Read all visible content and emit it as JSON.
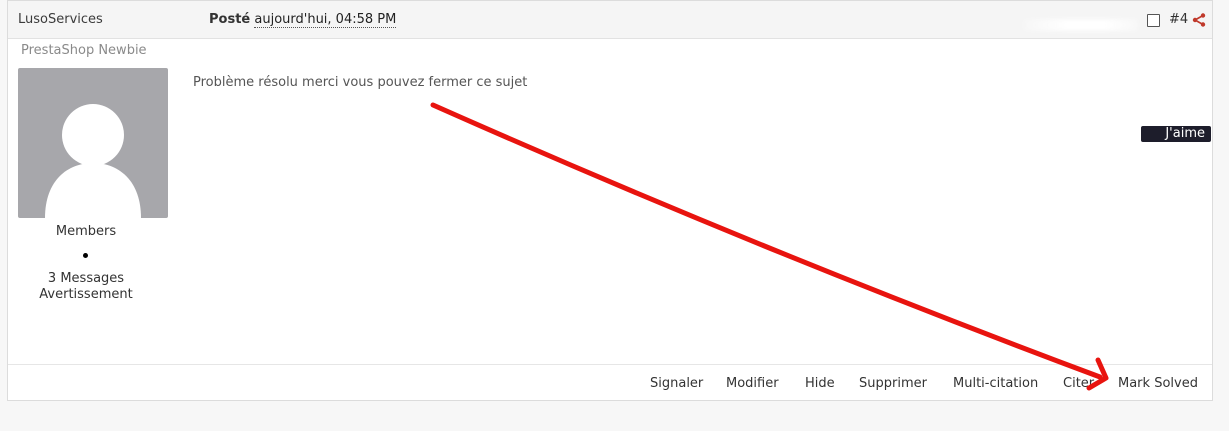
{
  "post": {
    "author": "LusoServices",
    "posted_prefix": "Posté",
    "posted_date": "aujourd'hui, 04:58 PM",
    "post_number": "#4",
    "rank": "PrestaShop Newbie",
    "group": "Members",
    "messages": "3 Messages",
    "warning": "Avertissement",
    "body": "Problème résolu merci vous pouvez fermer ce sujet",
    "like_label": "J'aime"
  },
  "controls": {
    "report": "Signaler",
    "edit": "Modifier",
    "hide": "Hide",
    "delete": "Supprimer",
    "multiquote": "Multi-citation",
    "quote": "Citer",
    "mark_solved": "Mark Solved"
  },
  "colors": {
    "annotation_arrow": "#e8140f",
    "share_icon": "#c0392b",
    "avatar_bg": "#a7a7ab"
  },
  "icons": {
    "share": "share-icon",
    "avatar": "default-avatar-icon",
    "checkbox": "select-checkbox"
  }
}
